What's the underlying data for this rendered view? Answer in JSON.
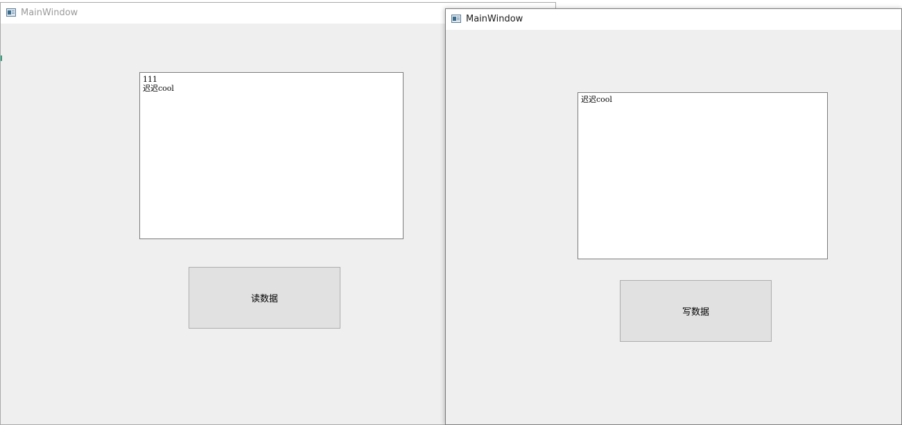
{
  "windows": [
    {
      "title": "MainWindow",
      "textbox_lines": [
        "111",
        "迟迟cool"
      ],
      "button_label": "读数据"
    },
    {
      "title": "MainWindow",
      "textbox_lines": [
        "迟迟cool"
      ],
      "button_label": "写数据"
    }
  ],
  "icons": {
    "window_icon": "qt-app-window-icon"
  }
}
